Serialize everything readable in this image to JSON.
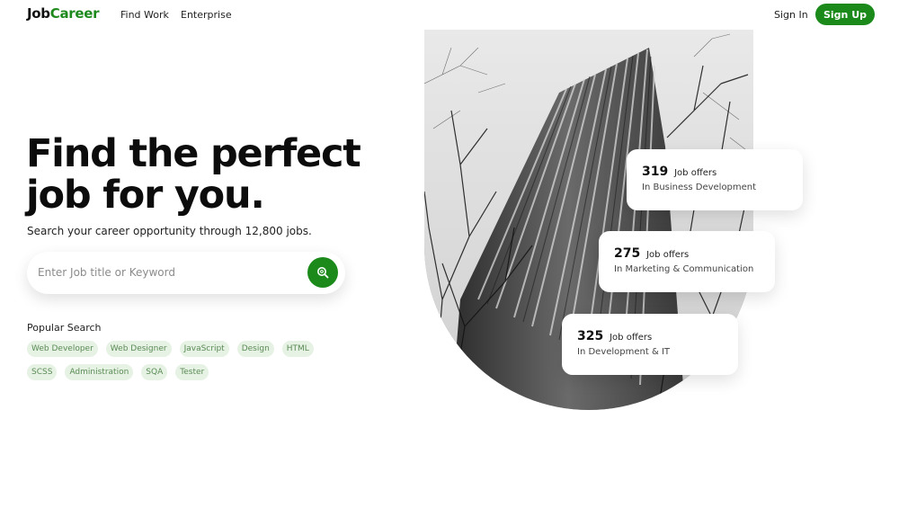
{
  "header": {
    "logo_part1": "Job",
    "logo_part2": "Career",
    "nav": [
      "Find Work",
      "Enterprise"
    ],
    "sign_in": "Sign In",
    "sign_up": "Sign Up"
  },
  "hero": {
    "headline_line1": "Find the perfect",
    "headline_line2": "job for you.",
    "subtitle": "Search your career opportunity through 12,800 jobs.",
    "search_placeholder": "Enter Job title or Keyword"
  },
  "popular": {
    "title": "Popular Search",
    "tags": [
      "Web Developer",
      "Web Designer",
      "JavaScript",
      "Design",
      "HTML",
      "SCSS",
      "Administration",
      "SQA",
      "Tester"
    ]
  },
  "stats": [
    {
      "count": "319",
      "label": "Job offers",
      "desc": "In Business Development"
    },
    {
      "count": "275",
      "label": "Job offers",
      "desc": "In Marketing & Communication"
    },
    {
      "count": "325",
      "label": "Job offers",
      "desc": "In Development & IT"
    }
  ],
  "colors": {
    "brand": "#1b8a1b",
    "tag_bg": "#e6f2e4",
    "tag_text": "#5a8a55"
  }
}
